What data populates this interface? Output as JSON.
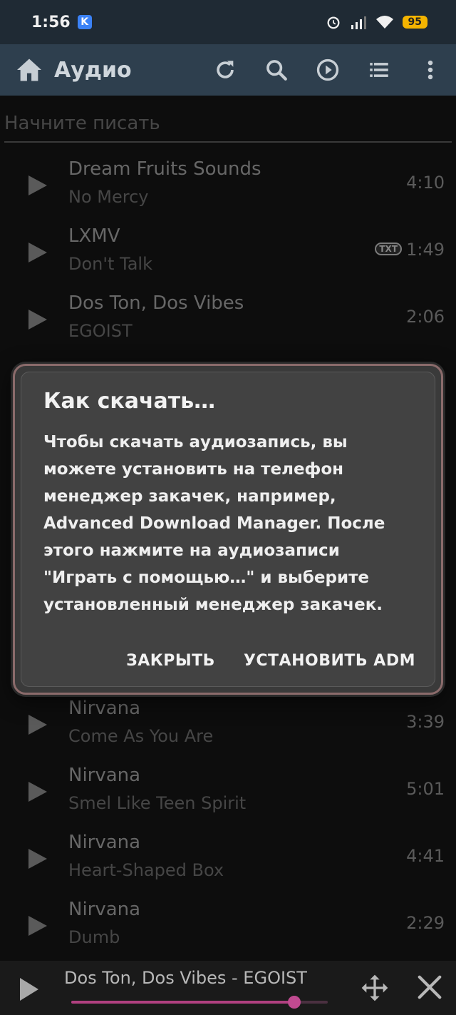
{
  "status_bar": {
    "time": "1:56",
    "app_badge": "K",
    "battery": "95"
  },
  "toolbar": {
    "title": "Аудио"
  },
  "search": {
    "placeholder": "Начните писать"
  },
  "tracks": [
    {
      "artist": "Dream Fruits Sounds",
      "title": "No Mercy",
      "duration": "4:10"
    },
    {
      "artist": "LXMV",
      "title": "Don't Talk",
      "duration": "1:49",
      "badge": "TXT"
    },
    {
      "artist": "Dos Ton, Dos Vibes",
      "title": "EGOIST",
      "duration": "2:06"
    },
    {
      "artist": "Nirvana",
      "title": "Come As You Are",
      "duration": "3:39"
    },
    {
      "artist": "Nirvana",
      "title": "Smel Like Teen Spirit",
      "duration": "5:01"
    },
    {
      "artist": "Nirvana",
      "title": "Heart-Shaped Box",
      "duration": "4:41"
    },
    {
      "artist": "Nirvana",
      "title": "Dumb",
      "duration": "2:29"
    }
  ],
  "dialog": {
    "title": "Как скачать…",
    "body": "Чтобы скачать аудиозапись, вы можете установить на телефон менеджер закачек, например, Advanced Download Manager. После этого нажмите на аудиозаписи \"Играть с помощью…\" и выберите установленный менеджер закачек.",
    "close_label": "ЗАКРЫТЬ",
    "install_label": "УСТАНОВИТЬ ADM"
  },
  "player": {
    "now_playing": "Dos Ton, Dos Vibes - EGOIST",
    "progress": 0.87
  }
}
